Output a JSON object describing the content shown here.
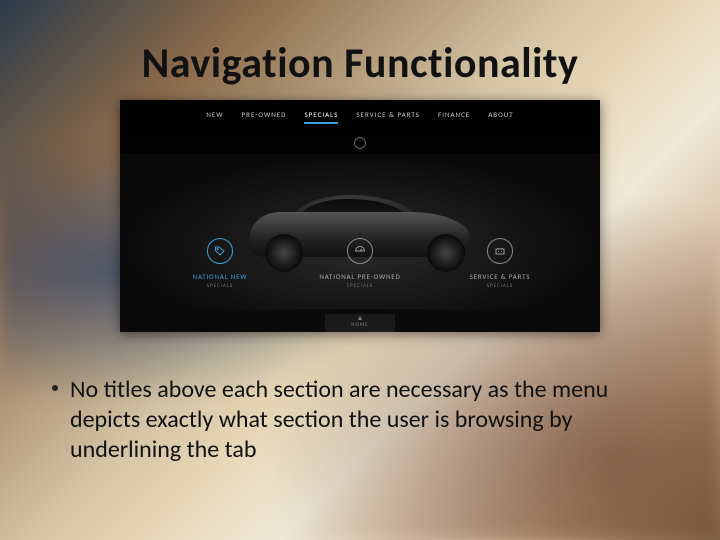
{
  "title": "Navigation Functionality",
  "nav": {
    "items": [
      {
        "label": "NEW"
      },
      {
        "label": "PRE-OWNED"
      },
      {
        "label": "SPECIALS"
      },
      {
        "label": "SERVICE & PARTS"
      },
      {
        "label": "FINANCE"
      },
      {
        "label": "ABOUT"
      }
    ],
    "active_index": 2
  },
  "cards": [
    {
      "icon": "tag-icon",
      "title": "NATIONAL NEW",
      "sub": "SPECIALS",
      "highlight": true
    },
    {
      "icon": "speedometer-icon",
      "title": "NATIONAL PRE-OWNED",
      "sub": "SPECIALS",
      "highlight": false
    },
    {
      "icon": "battery-icon",
      "title": "SERVICE & PARTS",
      "sub": "SPECIALS",
      "highlight": false
    }
  ],
  "home_tab": {
    "chevron": "▴",
    "label": "HOME"
  },
  "bullet_text": "No titles above each section are necessary as the menu depicts exactly what section the user is browsing by underlining the tab"
}
